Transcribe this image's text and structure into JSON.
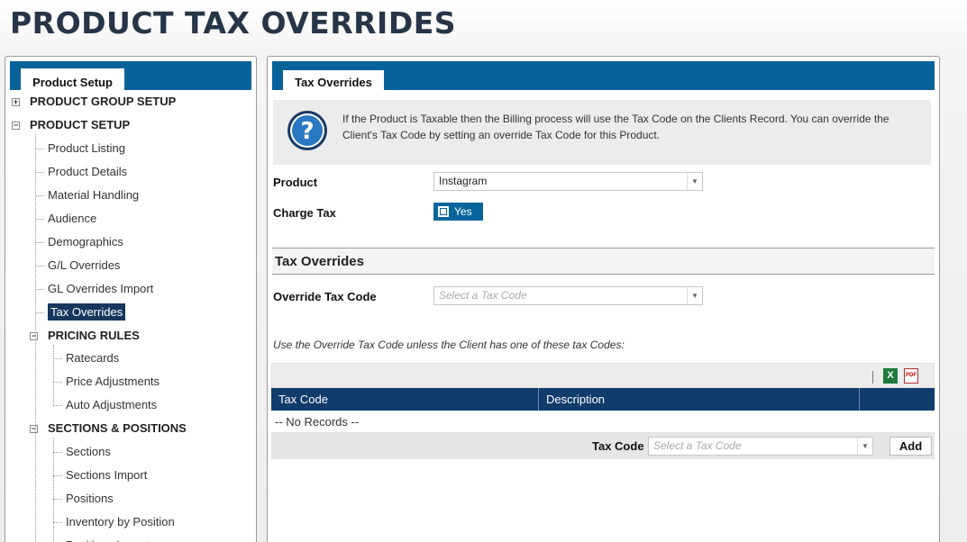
{
  "page": {
    "title": "PRODUCT TAX OVERRIDES"
  },
  "left_panel": {
    "tab_label": "Product Setup",
    "tree": [
      {
        "label": "PRODUCT GROUP SETUP",
        "kind": "group",
        "expander": "+"
      },
      {
        "label": "PRODUCT SETUP",
        "kind": "group",
        "expander": "−"
      },
      {
        "label": "Product Listing",
        "kind": "leaf"
      },
      {
        "label": "Product Details",
        "kind": "leaf"
      },
      {
        "label": "Material Handling",
        "kind": "leaf"
      },
      {
        "label": "Audience",
        "kind": "leaf"
      },
      {
        "label": "Demographics",
        "kind": "leaf"
      },
      {
        "label": "G/L Overrides",
        "kind": "leaf"
      },
      {
        "label": "GL Overrides Import",
        "kind": "leaf"
      },
      {
        "label": "Tax Overrides",
        "kind": "leaf",
        "active": true
      },
      {
        "label": "PRICING RULES",
        "kind": "subgroup",
        "expander": "−"
      },
      {
        "label": "Ratecards",
        "kind": "subleaf"
      },
      {
        "label": "Price Adjustments",
        "kind": "subleaf"
      },
      {
        "label": "Auto Adjustments",
        "kind": "subleaf"
      },
      {
        "label": "SECTIONS & POSITIONS",
        "kind": "subgroup",
        "expander": "−"
      },
      {
        "label": "Sections",
        "kind": "subleaf"
      },
      {
        "label": "Sections Import",
        "kind": "subleaf"
      },
      {
        "label": "Positions",
        "kind": "subleaf"
      },
      {
        "label": "Inventory by Position",
        "kind": "subleaf"
      },
      {
        "label": "Positions Import",
        "kind": "subleaf"
      }
    ]
  },
  "main": {
    "tab_label": "Tax Overrides",
    "info_text": "If the Product is Taxable then the Billing process will use the Tax Code on the Clients Record. You can override the Client's Tax Code by setting an override Tax Code for this Product.",
    "product_label": "Product",
    "product_value": "Instagram",
    "charge_tax_label": "Charge Tax",
    "charge_tax_value": "Yes",
    "section_title": "Tax Overrides",
    "override_label": "Override Tax Code",
    "override_placeholder": "Select a Tax Code",
    "note": "Use the Override Tax Code unless the Client has one of these tax Codes:",
    "grid": {
      "columns": [
        "Tax Code",
        "Description"
      ],
      "empty_text": "-- No Records --",
      "footer_label": "Tax Code",
      "footer_placeholder": "Select a Tax Code",
      "add_label": "Add",
      "excel_icon": "X",
      "pdf_icon": "PDF"
    }
  },
  "colors": {
    "header_blue": "#066299",
    "grid_header": "#0f3c6b",
    "active_item": "#16385e",
    "title": "#263547"
  }
}
